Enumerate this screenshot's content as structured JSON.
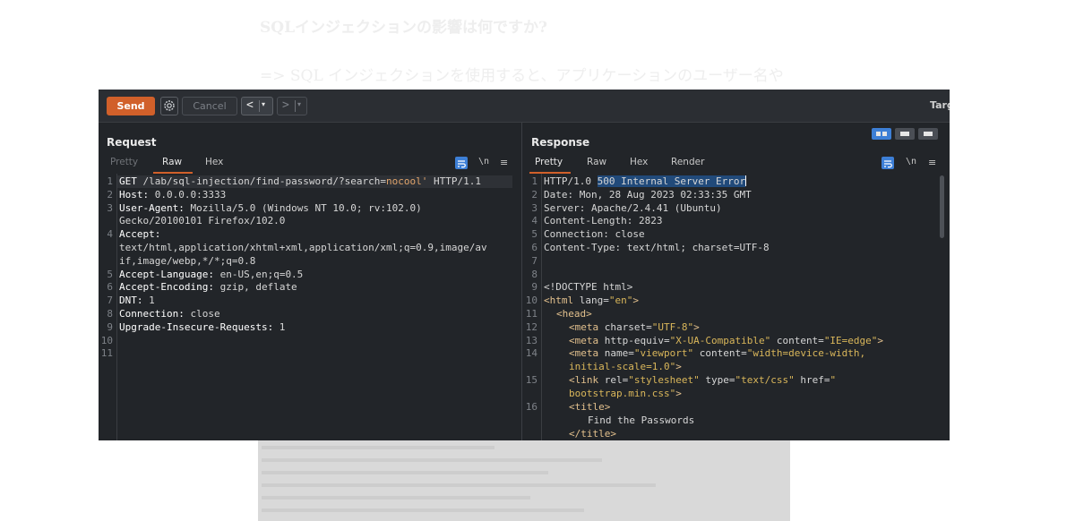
{
  "article": {
    "heading": "SQLインジェクションの影響は何ですか?",
    "line": "=> SQL インジェクションを使用すると、アプリケーションのユーザー名や"
  },
  "toolbar": {
    "send": "Send",
    "cancel": "Cancel",
    "back": "<",
    "forward": ">",
    "dropdown": "▾",
    "target": "Targ"
  },
  "request": {
    "title": "Request",
    "tabs": [
      "Pretty",
      "Raw",
      "Hex"
    ],
    "active_tab": "Raw",
    "icons": [
      "wrap-icon",
      "newline-icon",
      "menu-icon"
    ],
    "newline_label": "\\n",
    "menu_glyph": "≡",
    "line_numbers": [
      "1",
      "2",
      "3",
      "4",
      "5",
      "6",
      "7",
      "8",
      "9",
      "10",
      "11"
    ],
    "lines": {
      "l1_method": "GET ",
      "l1_path": "/lab/sql-injection/find-password/?search=",
      "l1_param": "nocool'",
      "l1_proto": " HTTP/1.1",
      "l2_key": "Host:",
      "l2_val": " 0.0.0.0:3333",
      "l3_key": "User-Agent:",
      "l3_val": " Mozilla/5.0 (Windows NT 10.0; rv:102.0)",
      "l3_cont": "Gecko/20100101 Firefox/102.0",
      "l4_key": "Accept:",
      "l4_cont1": "text/html,application/xhtml+xml,application/xml;q=0.9,image/av",
      "l4_cont2": "if,image/webp,*/*;q=0.8",
      "l5_key": "Accept-Language:",
      "l5_val": " en-US,en;q=0.5",
      "l6_key": "Accept-Encoding:",
      "l6_val": " gzip, deflate",
      "l7_key": "DNT:",
      "l7_val": " 1",
      "l8_key": "Connection:",
      "l8_val": " close",
      "l9_key": "Upgrade-Insecure-Requests:",
      "l9_val": " 1"
    }
  },
  "response": {
    "title": "Response",
    "tabs": [
      "Pretty",
      "Raw",
      "Hex",
      "Render"
    ],
    "active_tab": "Pretty",
    "newline_label": "\\n",
    "menu_glyph": "≡",
    "line_numbers": [
      "1",
      "2",
      "3",
      "4",
      "5",
      "6",
      "7",
      "8",
      "9",
      "10",
      "11",
      "12",
      "13",
      "14",
      "15",
      "16"
    ],
    "lines": {
      "l1_proto": "HTTP/1.0 ",
      "l1_status": "500 Internal Server Error",
      "l2": "Date: Mon, 28 Aug 2023 02:33:35 GMT",
      "l3": "Server: Apache/2.4.41 (Ubuntu)",
      "l4": "Content-Length: 2823",
      "l5": "Connection: close",
      "l6": "Content-Type: text/html; charset=UTF-8",
      "l9": "<!DOCTYPE html>",
      "l10_tag_open": "<html ",
      "l10_attr": "lang=",
      "l10_val": "\"en\"",
      "l10_close": ">",
      "l11": "<head>",
      "l12_tag": "<meta ",
      "l12_attr": "charset=",
      "l12_val": "\"UTF-8\"",
      "l12_close": ">",
      "l13_tag": "<meta ",
      "l13_attr": "http-equiv=",
      "l13_val": "\"X-UA-Compatible\"",
      "l13_attr2": " content=",
      "l13_val2": "\"IE=edge\"",
      "l13_close": ">",
      "l14_tag": "<meta ",
      "l14_attr": "name=",
      "l14_val": "\"viewport\"",
      "l14_attr2": " content=",
      "l14_val2": "\"width=device-width,",
      "l14_cont": "initial-scale=1.0\"",
      "l14_close": ">",
      "l15_tag": "<link ",
      "l15_attr": "rel=",
      "l15_val": "\"stylesheet\"",
      "l15_attr2": " type=",
      "l15_val2": "\"text/css\"",
      "l15_attr3": " href=",
      "l15_val3": "\"",
      "l15_cont": "bootstrap.min.css\"",
      "l15_close": ">",
      "l16": "<title>",
      "l16_text": "Find the Passwords",
      "l16_end": "</title>"
    }
  },
  "colors": {
    "accent": "#d1602a",
    "selection": "#214a7a",
    "toggle_active": "#3d7fd6"
  }
}
